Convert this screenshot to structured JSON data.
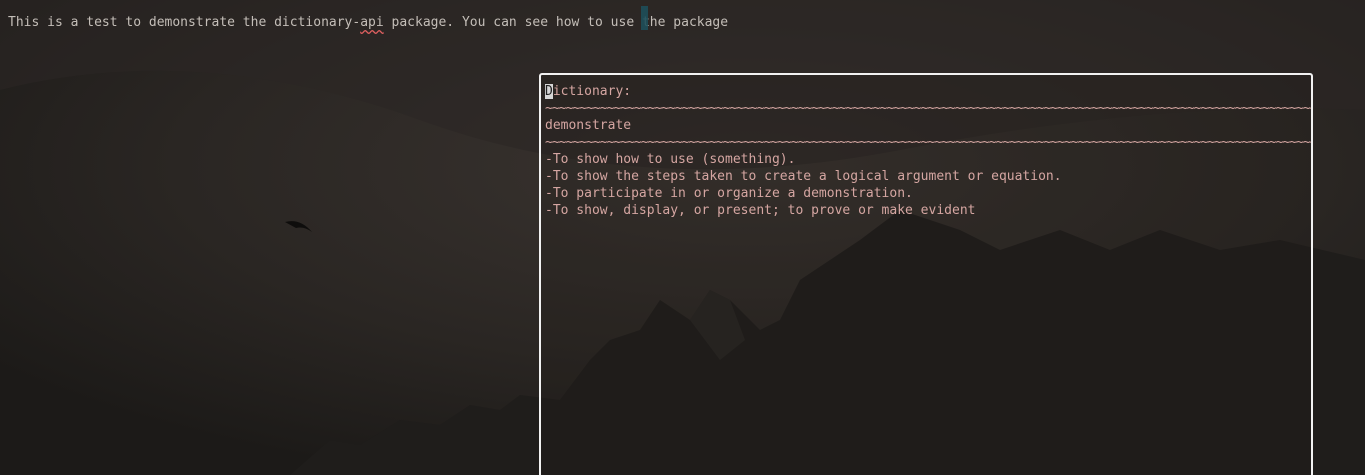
{
  "editor": {
    "line_before": "This is a test to demonstrate the dictionary-",
    "misspelled_word": "api",
    "line_middle": " package. You can see how to us",
    "cursor_char": "e",
    "line_after": " the package"
  },
  "popup": {
    "title_first_char": "D",
    "title_rest": "ictionary:",
    "separator": "~~~~~~~~~~~~~~~~~~~~~~~~~~~~~~~~~~~~~~~~~~~~~~~~~~~~~~~~~~~~~~~~~~~~~~~~~~~~~~~~~~~~~~~~~~~~~~~~~~~~~~~~~~~~~~~~~~~",
    "word": "demonstrate",
    "definitions": [
      "-To show how to use (something).",
      "-To show the steps taken to create a logical argument or equation.",
      "-To participate in or organize a demonstration.",
      "-To show, display, or present; to prove or make evident"
    ]
  },
  "colors": {
    "background": "#221f1d",
    "popup_text": "#d5a6a2",
    "popup_border": "#f2f2f2",
    "cursor_column": "#1e4f5a",
    "misspell_underline": "#e06060"
  }
}
